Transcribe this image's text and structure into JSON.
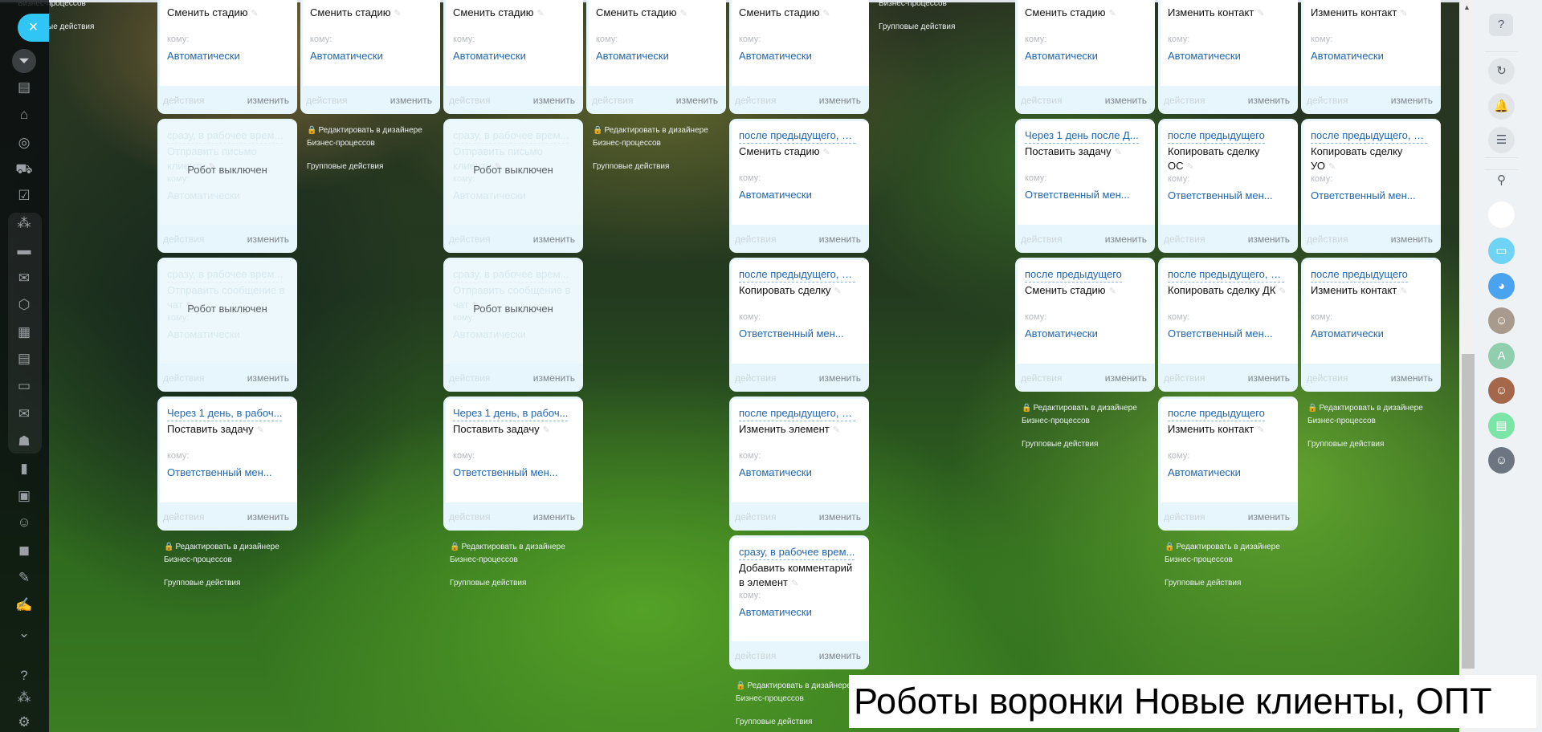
{
  "labels": {
    "to": "кому:",
    "actions": "действия",
    "edit": "изменить",
    "disabled": "Робот выключен",
    "designer_line1": "Редактировать в дизайнере",
    "designer_line2": "Бизнес-процессов",
    "group_actions": "Групповые действия",
    "close": "×",
    "pencil": "✎"
  },
  "sidebar": {
    "close_label": "×",
    "icons": [
      {
        "name": "funnel-icon",
        "glyph": "⏷"
      },
      {
        "name": "calendar-list-icon",
        "glyph": "▤"
      },
      {
        "name": "warehouse-icon",
        "glyph": "⌂"
      },
      {
        "name": "target-icon",
        "glyph": "◎"
      },
      {
        "name": "cart-icon",
        "glyph": "⛟"
      },
      {
        "name": "tasks-icon",
        "glyph": "☑"
      },
      {
        "name": "sites-icon",
        "glyph": "⁂"
      },
      {
        "name": "window-icon",
        "glyph": "▬"
      },
      {
        "name": "chat-icon",
        "glyph": "✉"
      },
      {
        "name": "hexagon-icon",
        "glyph": "⬡"
      },
      {
        "name": "calendar-icon",
        "glyph": "▦"
      },
      {
        "name": "document-icon",
        "glyph": "▤"
      },
      {
        "name": "drive-icon",
        "glyph": "▭"
      },
      {
        "name": "mail-icon",
        "glyph": "✉"
      },
      {
        "name": "team-icon",
        "glyph": "☗"
      },
      {
        "name": "analytics-icon",
        "glyph": "▮"
      },
      {
        "name": "contact-card-icon",
        "glyph": "▣"
      },
      {
        "name": "robot-icon",
        "glyph": "☺"
      },
      {
        "name": "box-icon",
        "glyph": "◼"
      },
      {
        "name": "edit-list-icon",
        "glyph": "✎"
      },
      {
        "name": "signature-icon",
        "glyph": "✍"
      },
      {
        "name": "chevron-down-icon",
        "glyph": "⌄"
      },
      {
        "name": "help-icon",
        "glyph": "?"
      },
      {
        "name": "network-icon",
        "glyph": "⁂"
      },
      {
        "name": "gear-icon",
        "glyph": "⚙"
      }
    ]
  },
  "columns": [
    {
      "robots": [],
      "links": true
    },
    {
      "robots": [
        {
          "title": "Сменить стадию",
          "to": "Автоматически"
        },
        {
          "delay": "сразу, в рабочее врем...",
          "title": "Отправить письмо клиенту",
          "to": "Автоматически",
          "disabled": true
        },
        {
          "delay": "сразу, в рабочее врем...",
          "title": "Отправить сообщение в чат",
          "to": "Автоматически",
          "disabled": true
        },
        {
          "delay": "Через 1 день, в рабоч...",
          "title": "Поставить задачу",
          "to": "Ответственный мен..."
        }
      ],
      "links": true
    },
    {
      "robots": [
        {
          "title": "Сменить стадию",
          "to": "Автоматически"
        }
      ],
      "links": true
    },
    {
      "robots": [
        {
          "title": "Сменить стадию",
          "to": "Автоматически"
        },
        {
          "delay": "сразу, в рабочее врем...",
          "title": "Отправить письмо клиенту",
          "to": "Автоматически",
          "disabled": true
        },
        {
          "delay": "сразу, в рабочее врем...",
          "title": "Отправить сообщение в чат",
          "to": "Автоматически",
          "disabled": true
        },
        {
          "delay": "Через 1 день, в рабоч...",
          "title": "Поставить задачу",
          "to": "Ответственный мен..."
        }
      ],
      "links": true
    },
    {
      "robots": [
        {
          "title": "Сменить стадию",
          "to": "Автоматически"
        }
      ],
      "links": true
    },
    {
      "robots": [
        {
          "title": "Сменить стадию",
          "to": "Автоматически"
        },
        {
          "delay": "после предыдущего, п...",
          "title": "Сменить стадию",
          "to": "Автоматически"
        },
        {
          "delay": "после предыдущего, п...",
          "title": "Копировать сделку",
          "to": "Ответственный мен..."
        },
        {
          "delay": "после предыдущего, п...",
          "title": "Изменить элемент",
          "to": "Автоматически"
        },
        {
          "delay": "сразу, в рабочее врем...",
          "title": "Добавить комментарий в элемент",
          "to": "Автоматически"
        }
      ],
      "links": true
    },
    {
      "robots": [],
      "links": true
    },
    {
      "robots": [
        {
          "title": "Сменить стадию",
          "to": "Автоматически"
        },
        {
          "delay": "Через 1 день после Д...",
          "title": "Поставить задачу",
          "to": "Ответственный мен..."
        },
        {
          "delay": "после предыдущего",
          "title": "Сменить стадию",
          "to": "Автоматически"
        }
      ],
      "links": true
    },
    {
      "robots": [
        {
          "title": "Изменить контакт",
          "to": "Автоматически"
        },
        {
          "delay": "после предыдущего",
          "title": "Копировать сделку ОС",
          "to": "Ответственный мен..."
        },
        {
          "delay": "после предыдущего, п...",
          "title": "Копировать сделку ДК",
          "to": "Ответственный мен..."
        },
        {
          "delay": "после предыдущего",
          "title": "Изменить контакт",
          "to": "Автоматически"
        }
      ],
      "links": true
    },
    {
      "robots": [
        {
          "title": "Изменить контакт",
          "to": "Автоматически"
        },
        {
          "delay": "после предыдущего, п...",
          "title": "Копировать сделку УО",
          "to": "Ответственный мен..."
        },
        {
          "delay": "после предыдущего",
          "title": "Изменить контакт",
          "to": "Автоматически"
        }
      ],
      "links": true
    }
  ],
  "right_panel": {
    "items": [
      {
        "name": "help-icon",
        "glyph": "?",
        "bg": "#dde2e6"
      },
      {
        "name": "copilot-icon",
        "glyph": "↻",
        "bg": "#e1e5e8"
      },
      {
        "name": "bell-icon",
        "glyph": "🔔",
        "bg": "#e1e5e8"
      },
      {
        "name": "messenger-icon",
        "glyph": "☰",
        "bg": "#e1e5e8"
      },
      {
        "name": "search-icon",
        "glyph": "⚲",
        "bg": "transparent"
      },
      {
        "name": "bot-avatar",
        "glyph": "☻",
        "bg": "#ffffff"
      },
      {
        "name": "open-lines-avatar",
        "glyph": "▭",
        "bg": "#6fd3f5"
      },
      {
        "name": "vk-avatar",
        "glyph": "◕",
        "bg": "#4aa3ee"
      },
      {
        "name": "user-avatar",
        "glyph": "☺",
        "bg": "#a89a8c"
      },
      {
        "name": "user-avatar-a",
        "glyph": "A",
        "bg": "#8fcfae"
      },
      {
        "name": "user-avatar-woman",
        "glyph": "☺",
        "bg": "#a4674a"
      },
      {
        "name": "news-avatar",
        "glyph": "▤",
        "bg": "#7be5a8"
      },
      {
        "name": "user-avatar-dark",
        "glyph": "☺",
        "bg": "#6d7580"
      }
    ]
  },
  "caption": "Роботы воронки Новые клиенты, ОПТ"
}
